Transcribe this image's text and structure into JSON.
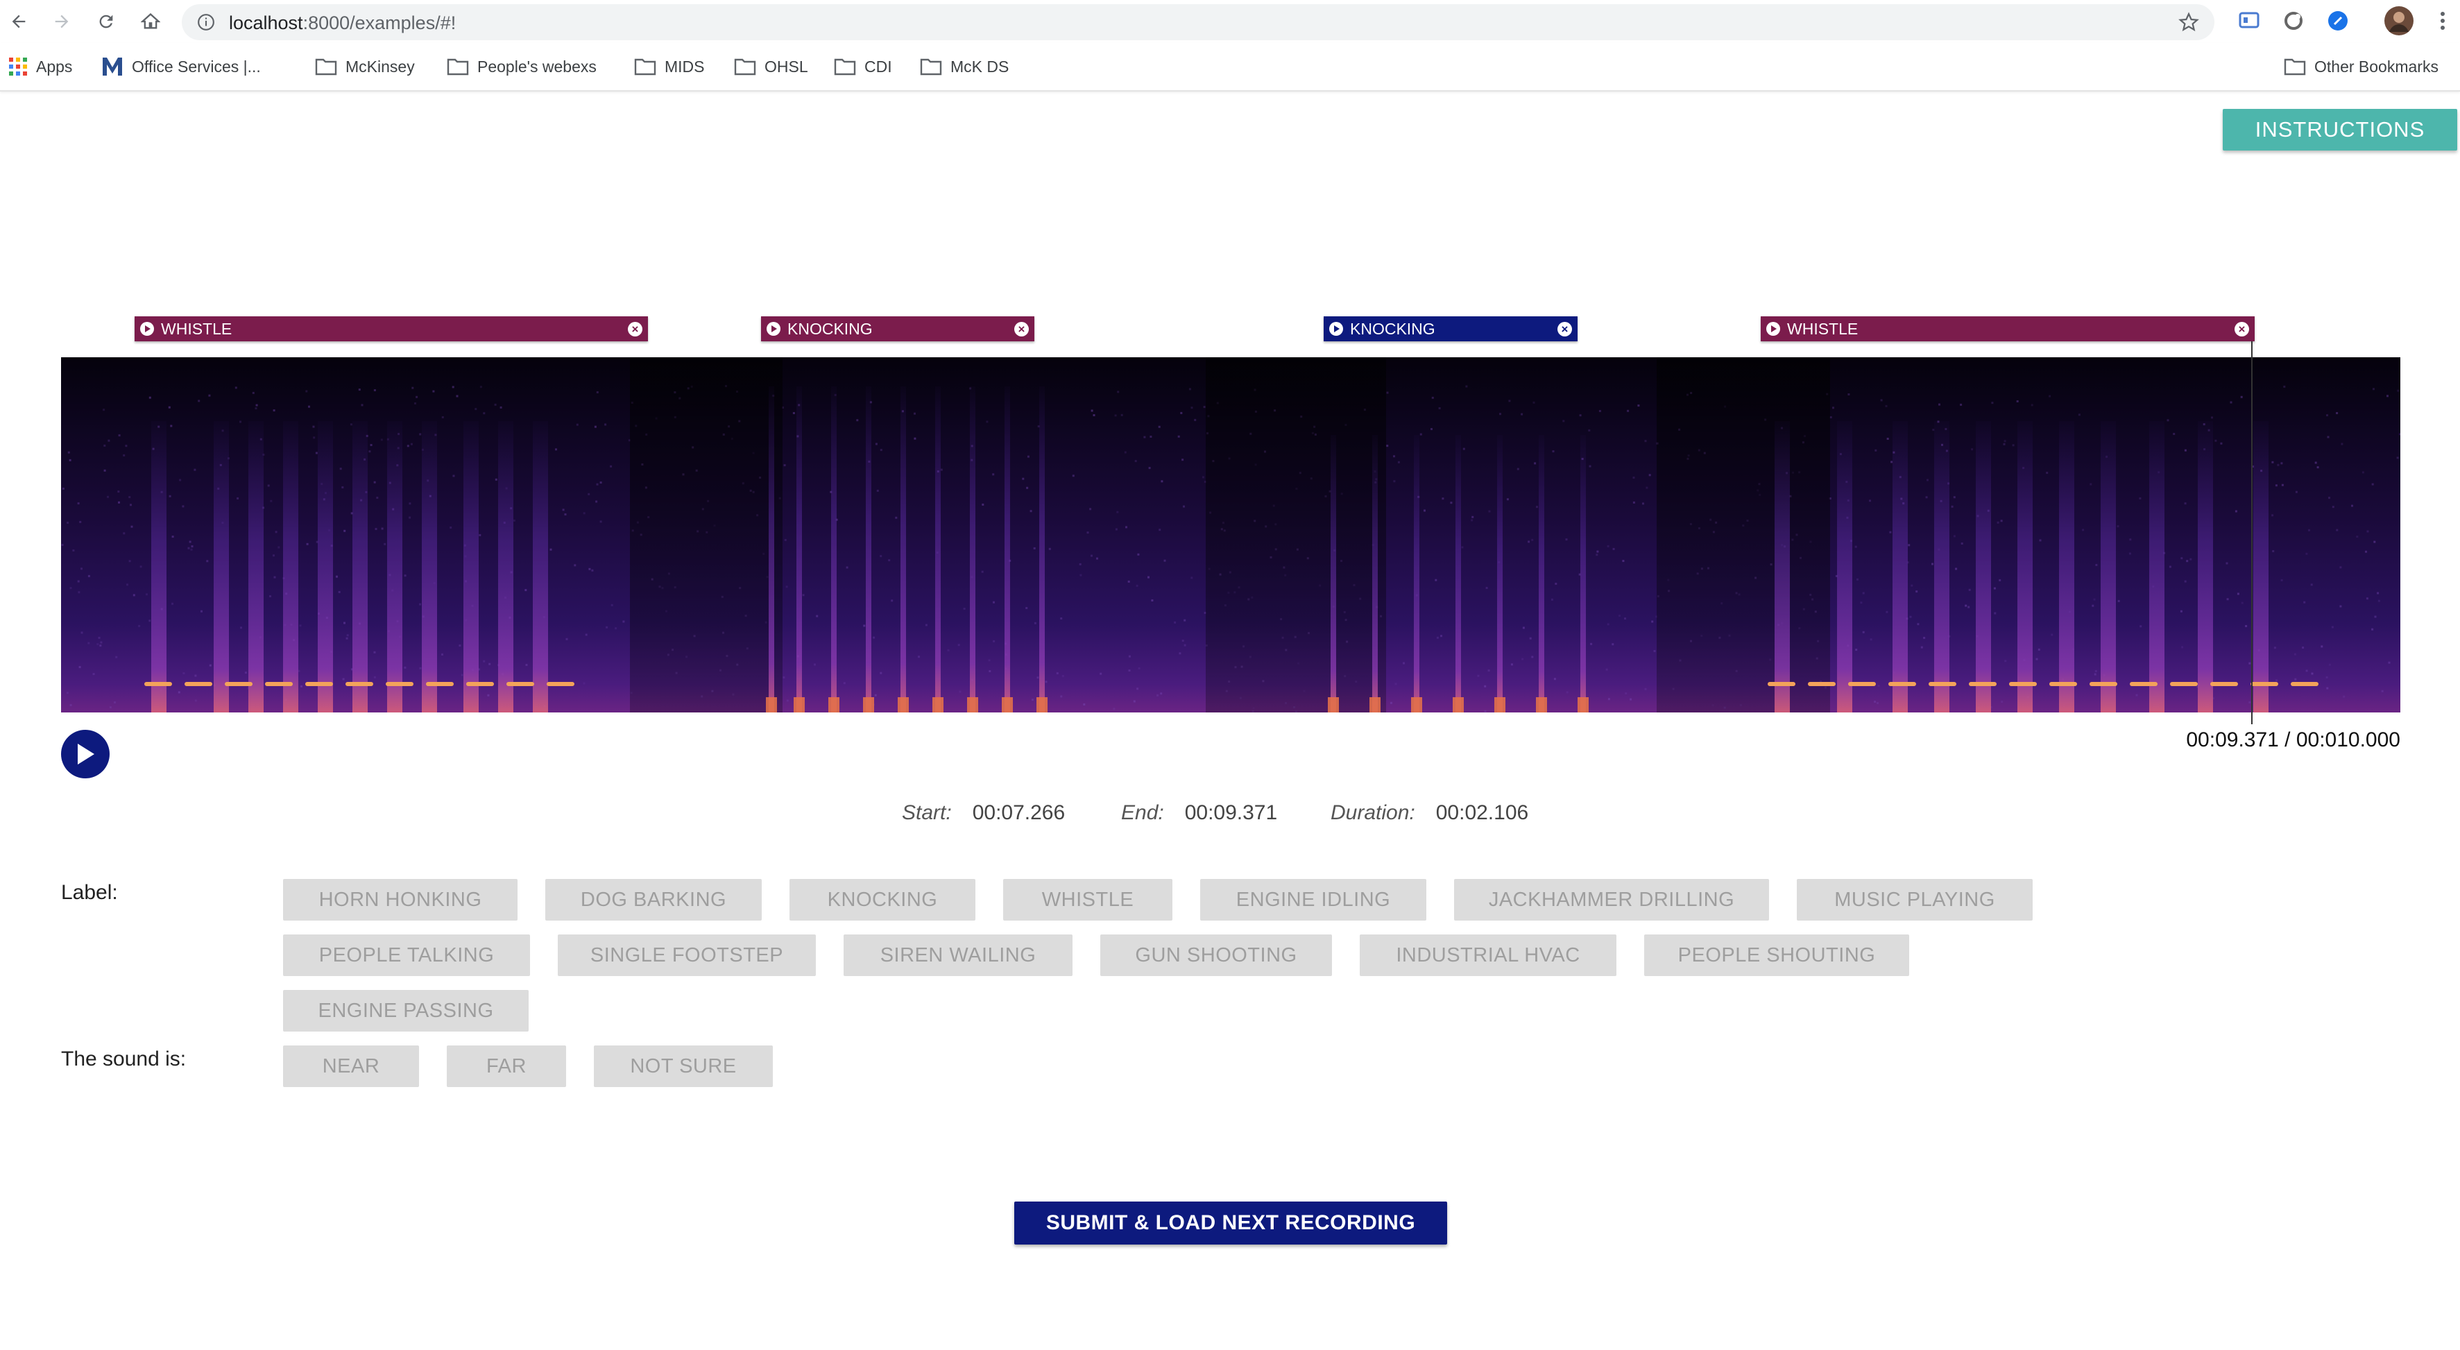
{
  "browser": {
    "url_host": "localhost",
    "url_path": ":8000/examples/#!",
    "bookmarks": [
      {
        "label": "Apps",
        "icon": "apps-grid-icon"
      },
      {
        "label": "Office Services |...",
        "icon": "office-logo-icon"
      },
      {
        "label": "McKinsey",
        "icon": "folder-icon"
      },
      {
        "label": "People's webexs",
        "icon": "folder-icon"
      },
      {
        "label": "MIDS",
        "icon": "folder-icon"
      },
      {
        "label": "OHSL",
        "icon": "folder-icon"
      },
      {
        "label": "CDI",
        "icon": "folder-icon"
      },
      {
        "label": "McK DS",
        "icon": "folder-icon"
      }
    ],
    "other_bookmarks": "Other Bookmarks"
  },
  "page": {
    "instructions_label": "INSTRUCTIONS",
    "regions": [
      {
        "label": "WHISTLE",
        "color": "#7b1c4c"
      },
      {
        "label": "KNOCKING",
        "color": "#7b1c4c"
      },
      {
        "label": "KNOCKING",
        "color": "#0d1a7e"
      },
      {
        "label": "WHISTLE",
        "color": "#7b1c4c"
      }
    ],
    "time_readout": "00:09.371 / 00:010.000",
    "start_label": "Start:",
    "start_value": "00:07.266",
    "end_label": "End:",
    "end_value": "00:09.371",
    "duration_label": "Duration:",
    "duration_value": "00:02.106",
    "label_heading": "Label:",
    "labels": [
      "HORN HONKING",
      "DOG BARKING",
      "KNOCKING",
      "WHISTLE",
      "ENGINE IDLING",
      "JACKHAMMER DRILLING",
      "MUSIC PLAYING",
      "PEOPLE TALKING",
      "SINGLE FOOTSTEP",
      "SIREN WAILING",
      "GUN SHOOTING",
      "INDUSTRIAL HVAC",
      "PEOPLE SHOUTING",
      "ENGINE PASSING"
    ],
    "proximity_heading": "The sound is:",
    "proximity": [
      "NEAR",
      "FAR",
      "NOT SURE"
    ],
    "submit_label": "SUBMIT & LOAD NEXT RECORDING"
  },
  "colors": {
    "primary": "#0d1a7e",
    "region_default": "#7b1c4c",
    "instructions": "#4db6ac",
    "chip_bg": "#dcdcdc",
    "chip_text": "#9e9e9e"
  }
}
